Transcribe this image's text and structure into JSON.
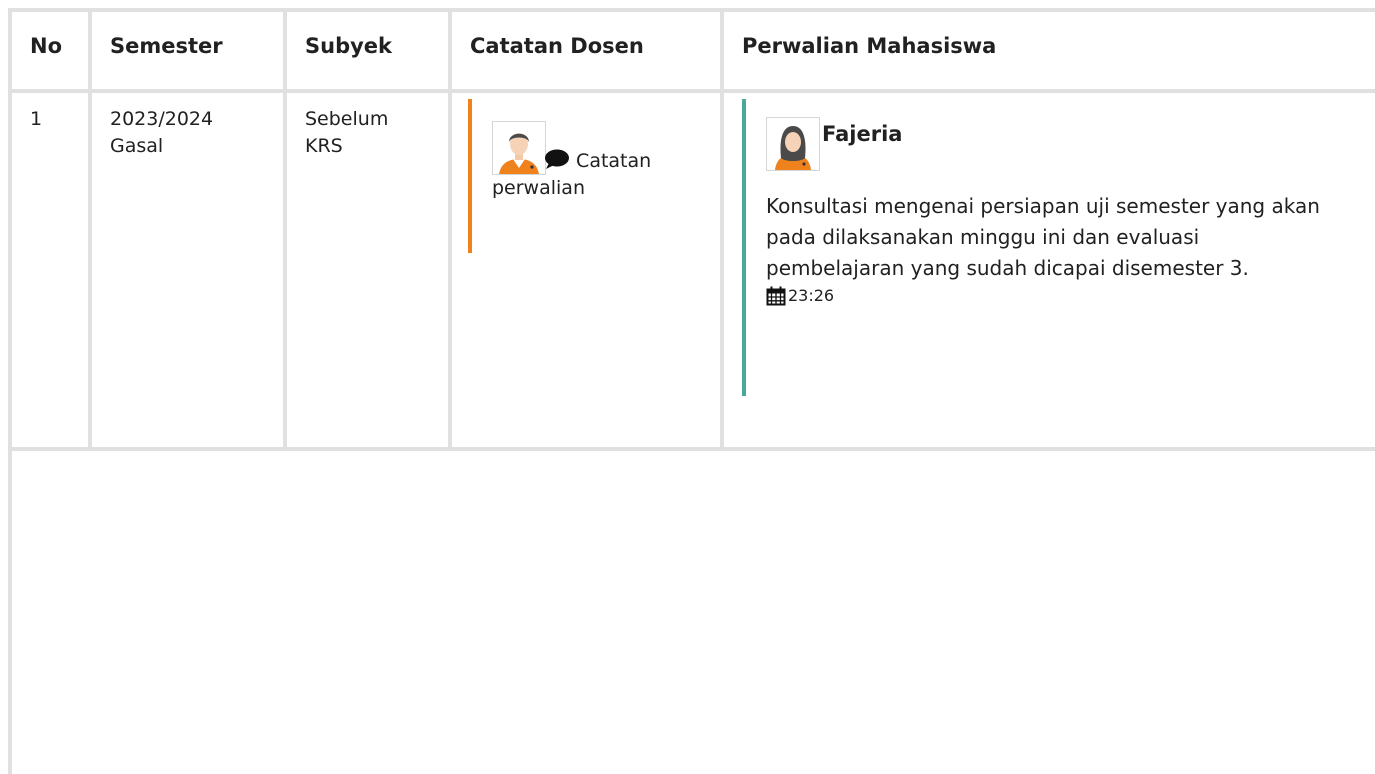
{
  "table": {
    "headers": {
      "no": "No",
      "semester": "Semester",
      "subyek": "Subyek",
      "catatan_dosen": "Catatan Dosen",
      "perwalian_mahasiswa": "Perwalian Mahasiswa"
    },
    "rows": [
      {
        "no": "1",
        "semester_line1": "2023/2024",
        "semester_line2": "Gasal",
        "subyek_line1": "Sebelum",
        "subyek_line2": "KRS",
        "catatan_dosen": {
          "avatar_icon": "male-lecturer-avatar-icon",
          "chat_icon": "comment-icon",
          "text": "Catatan perwalian"
        },
        "perwalian_mahasiswa": {
          "avatar_icon": "female-student-avatar-icon",
          "name": "Fajeria",
          "message": "Konsultasi mengenai persiapan uji semester yang akan pada dilaksanakan minggu ini dan evaluasi pembelajaran yang sudah dicapai disemester 3.",
          "time_icon": "calendar-icon",
          "time": "23:26"
        }
      }
    ]
  },
  "colors": {
    "grid_border": "#e0e0e0",
    "dosen_accent": "#f0821e",
    "mahasiswa_accent": "#4aa89a",
    "text": "#212121"
  }
}
